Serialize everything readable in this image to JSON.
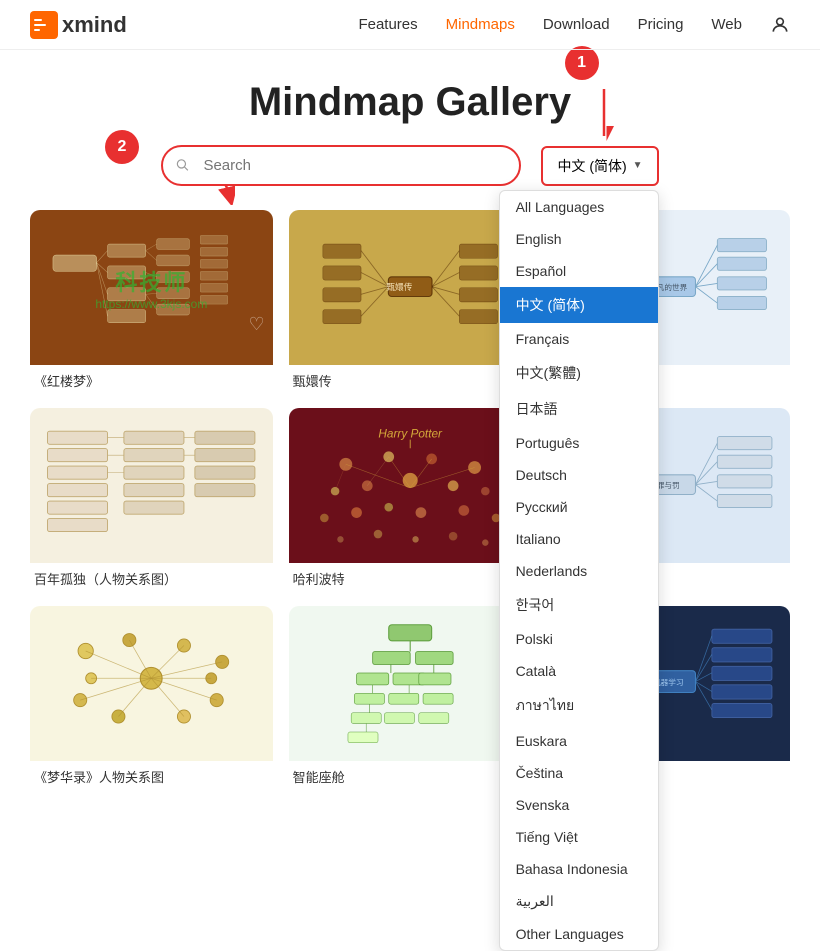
{
  "header": {
    "logo": "xmind",
    "nav": [
      {
        "label": "Features",
        "active": false
      },
      {
        "label": "Mindmaps",
        "active": true
      },
      {
        "label": "Download",
        "active": false
      },
      {
        "label": "Pricing",
        "active": false
      },
      {
        "label": "Web",
        "active": false
      }
    ]
  },
  "page": {
    "title": "Mindmap Gallery"
  },
  "search": {
    "placeholder": "Search"
  },
  "annotations": {
    "circle1": "1",
    "circle2": "2"
  },
  "language_button": {
    "label": "中文 (简体)",
    "chevron": "▼"
  },
  "language_options": [
    {
      "label": "All Languages",
      "selected": false
    },
    {
      "label": "English",
      "selected": false
    },
    {
      "label": "Español",
      "selected": false
    },
    {
      "label": "中文 (简体)",
      "selected": true
    },
    {
      "label": "Français",
      "selected": false
    },
    {
      "label": "中文(繁體)",
      "selected": false
    },
    {
      "label": "日本語",
      "selected": false
    },
    {
      "label": "Português",
      "selected": false
    },
    {
      "label": "Deutsch",
      "selected": false
    },
    {
      "label": "Русский",
      "selected": false
    },
    {
      "label": "Italiano",
      "selected": false
    },
    {
      "label": "Nederlands",
      "selected": false
    },
    {
      "label": "한국어",
      "selected": false
    },
    {
      "label": "Polski",
      "selected": false
    },
    {
      "label": "Català",
      "selected": false
    },
    {
      "label": "ภาษาไทย",
      "selected": false
    },
    {
      "label": "Euskara",
      "selected": false
    },
    {
      "label": "Čeština",
      "selected": false
    },
    {
      "label": "Svenska",
      "selected": false
    },
    {
      "label": "Tiếng Việt",
      "selected": false
    },
    {
      "label": "Bahasa Indonesia",
      "selected": false
    },
    {
      "label": "العربية",
      "selected": false
    },
    {
      "label": "Other Languages",
      "selected": false
    }
  ],
  "gallery": {
    "cards": [
      {
        "label": "《红楼梦》",
        "thumb_class": "thumb-brown",
        "has_watermark": true
      },
      {
        "label": "甄嬛传",
        "thumb_class": "thumb-gold",
        "has_watermark": false
      },
      {
        "label": "《平凡的世界》",
        "thumb_class": "thumb-lightblue",
        "has_watermark": false
      },
      {
        "label": "百年孤独（人物关系图）",
        "thumb_class": "thumb-cream",
        "has_watermark": false
      },
      {
        "label": "哈利波特",
        "thumb_class": "thumb-darkred",
        "has_watermark": false
      },
      {
        "label": "《罪与罚》",
        "thumb_class": "thumb-lightblue2",
        "has_watermark": false
      },
      {
        "label": "《梦华录》人物关系图",
        "thumb_class": "thumb-lightyellow",
        "has_watermark": false
      },
      {
        "label": "智能座舱",
        "thumb_class": "thumb-white",
        "has_watermark": false
      },
      {
        "label": "机器学习",
        "thumb_class": "thumb-darkblue",
        "has_watermark": false
      }
    ]
  }
}
